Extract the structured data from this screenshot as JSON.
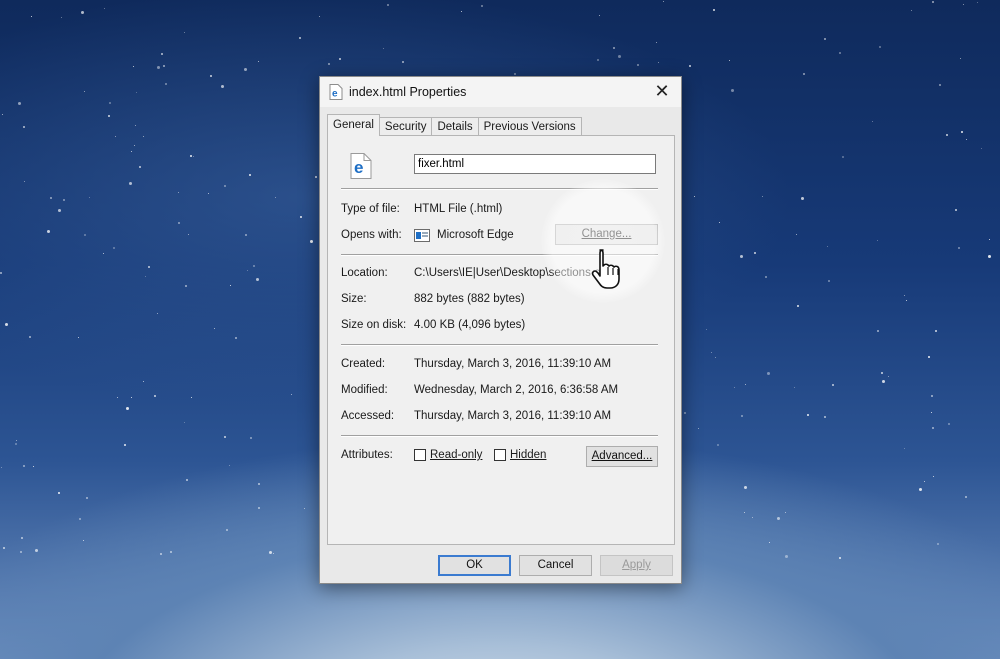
{
  "window": {
    "title": "index.html Properties",
    "close_label": "✕"
  },
  "tabs": [
    {
      "label": "General",
      "active": true
    },
    {
      "label": "Security",
      "active": false
    },
    {
      "label": "Details",
      "active": false
    },
    {
      "label": "Previous Versions",
      "active": false
    }
  ],
  "general": {
    "file_name_value": "fixer.html",
    "type_label": "Type of file:",
    "type_value": "HTML File (.html)",
    "opens_label": "Opens with:",
    "opens_value": "Microsoft Edge",
    "change_button": "Change...",
    "location_label": "Location:",
    "location_value": "C:\\Users\\IE|User\\Desktop\\sections-gh",
    "size_label": "Size:",
    "size_value": "882 bytes (882 bytes)",
    "size_on_disk_label": "Size on disk:",
    "size_on_disk_value": "4.00 KB (4,096 bytes)",
    "created_label": "Created:",
    "created_value": "Thursday, March 3, 2016, 11:39:10 AM",
    "modified_label": "Modified:",
    "modified_value": "Wednesday, March 2, 2016, 6:36:58 AM",
    "accessed_label": "Accessed:",
    "accessed_value": "Thursday, March 3, 2016, 11:39:10 AM",
    "attributes_label": "Attributes:",
    "readonly_label": "Read-only",
    "readonly_checked": false,
    "hidden_label": "Hidden",
    "hidden_checked": false,
    "advanced_button": "Advanced..."
  },
  "footer": {
    "ok_label": "OK",
    "cancel_label": "Cancel",
    "apply_label": "Apply"
  },
  "icons": {
    "file": "edge-file-icon",
    "app": "microsoft-edge-icon",
    "cursor": "hand-pointer-icon"
  },
  "colors": {
    "edge_blue": "#1f6fc5",
    "default_button_border": "#3b7bd0"
  }
}
